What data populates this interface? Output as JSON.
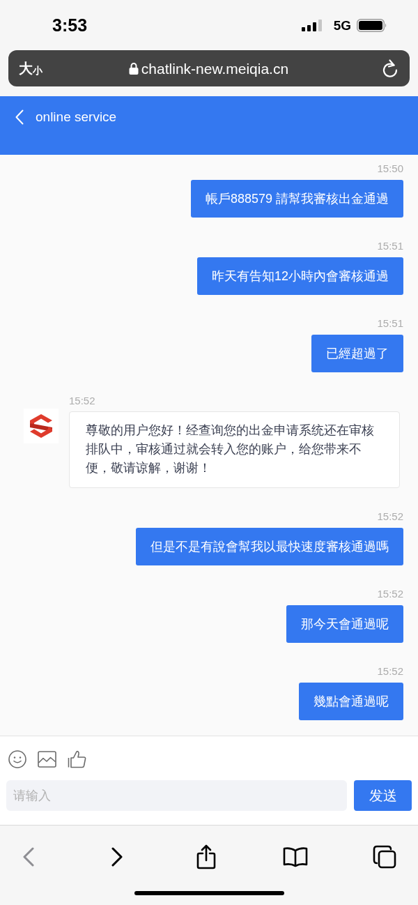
{
  "status_bar": {
    "time": "3:53",
    "network": "5G"
  },
  "address_bar": {
    "text_size_button": "大$_{小}$",
    "url": "chatlink-new.meiqia.cn"
  },
  "header": {
    "title": "online service"
  },
  "messages": [
    {
      "kind": "outgoing",
      "time": "15:50",
      "text": "帳戶888579 請幫我審核出金通過"
    },
    {
      "kind": "outgoing",
      "time": "15:51",
      "text": "昨天有告知12小時內會審核通過"
    },
    {
      "kind": "outgoing",
      "time": "15:51",
      "text": "已經超過了"
    },
    {
      "kind": "incoming",
      "time": "15:52",
      "text": "尊敬的用户您好！经查询您的出金申请系统还在审核排队中，审核通过就会转入您的账户，给您带来不便，敬请谅解，谢谢！"
    },
    {
      "kind": "outgoing",
      "time": "15:52",
      "text": "但是不是有說會幫我以最快速度審核通過嗎"
    },
    {
      "kind": "outgoing",
      "time": "15:52",
      "text": "那今天會通過呢"
    },
    {
      "kind": "outgoing",
      "time": "15:52",
      "text": "幾點會通過呢"
    }
  ],
  "composer": {
    "placeholder": "请输入",
    "send_button": "发送"
  },
  "browser_toolbar": [
    {
      "kind": "back",
      "disabled": true
    },
    {
      "kind": "forward",
      "disabled": false
    },
    {
      "kind": "share",
      "disabled": false
    },
    {
      "kind": "bookmarks",
      "disabled": false
    },
    {
      "kind": "tabs",
      "disabled": false
    }
  ]
}
